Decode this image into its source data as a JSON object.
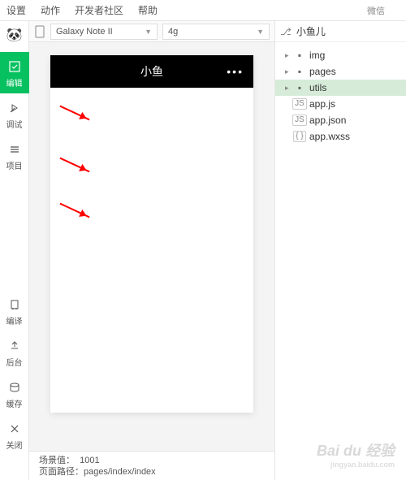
{
  "topbar": {
    "settings": "设置",
    "actions": "动作",
    "community": "开发者社区",
    "help": "帮助",
    "right": "微信"
  },
  "sidebar": {
    "edit": "编辑",
    "debug": "调试",
    "project": "项目",
    "compile": "编译",
    "backend": "后台",
    "cache": "缓存",
    "close": "关闭"
  },
  "toolbar": {
    "device": "Galaxy Note II",
    "network": "4g"
  },
  "simulator": {
    "title": "小鱼"
  },
  "statusbar": {
    "scene_label": "场景值：",
    "scene_value": "1001",
    "path_label": "页面路径：",
    "path_value": "pages/index/index"
  },
  "filepanel": {
    "project_name": "小鱼儿",
    "tree": [
      {
        "type": "folder",
        "name": "img"
      },
      {
        "type": "folder",
        "name": "pages"
      },
      {
        "type": "folder",
        "name": "utils",
        "selected": true
      },
      {
        "type": "file",
        "name": "app.js",
        "ext": "JS"
      },
      {
        "type": "file",
        "name": "app.json",
        "ext": "JS"
      },
      {
        "type": "file",
        "name": "app.wxss",
        "ext": "{ }"
      }
    ]
  },
  "watermark": {
    "main": "Bai du 经验",
    "sub": "jingyan.baidu.com"
  }
}
